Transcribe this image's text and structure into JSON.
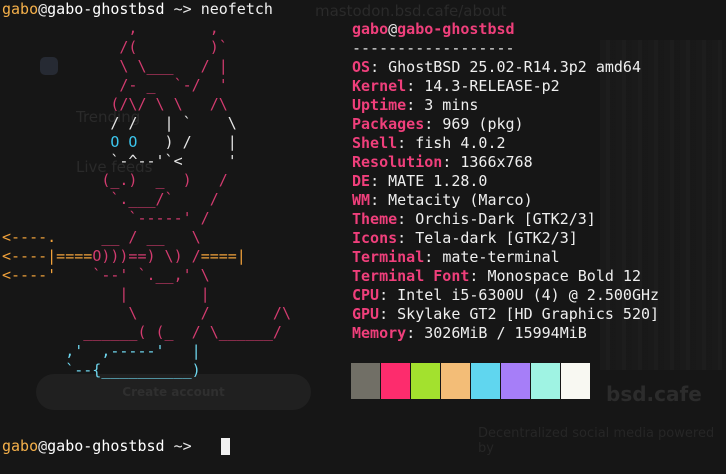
{
  "background": {
    "top_text": "mastodon.bsd.cafe/about",
    "side_items": [
      "Trending",
      "Live feeds"
    ],
    "button_label": "Create account",
    "brand": "bsd.cafe",
    "tagline": "Decentralized social media powered by"
  },
  "prompt1": {
    "user": "gabo",
    "at": "@",
    "host": "gabo-ghostbsd",
    "arrow": " ~> ",
    "command": "neofetch"
  },
  "prompt2": {
    "user": "gabo",
    "at": "@",
    "host": "gabo-ghostbsd",
    "arrow": " ~> "
  },
  "info": {
    "title_user": "gabo",
    "title_at": "@",
    "title_host": "gabo-ghostbsd",
    "separator": "------------------",
    "rows": [
      {
        "label": "OS",
        "value": "GhostBSD 25.02-R14.3p2 amd64"
      },
      {
        "label": "Kernel",
        "value": "14.3-RELEASE-p2"
      },
      {
        "label": "Uptime",
        "value": "3 mins"
      },
      {
        "label": "Packages",
        "value": "969 (pkg)"
      },
      {
        "label": "Shell",
        "value": "fish 4.0.2"
      },
      {
        "label": "Resolution",
        "value": "1366x768"
      },
      {
        "label": "DE",
        "value": "MATE 1.28.0"
      },
      {
        "label": "WM",
        "value": "Metacity (Marco)"
      },
      {
        "label": "Theme",
        "value": "Orchis-Dark [GTK2/3]"
      },
      {
        "label": "Icons",
        "value": "Tela-dark [GTK2/3]"
      },
      {
        "label": "Terminal",
        "value": "mate-terminal"
      },
      {
        "label": "Terminal Font",
        "value": "Monospace Bold 12"
      },
      {
        "label": "CPU",
        "value": "Intel i5-6300U (4) @ 2.500GHz"
      },
      {
        "label": "GPU",
        "value": "Skylake GT2 [HD Graphics 520]"
      },
      {
        "label": "Memory",
        "value": "3026MiB / 15994MiB"
      }
    ]
  },
  "art": {
    "l1": "              ,        ,",
    "l2": "             /(        )`",
    "l3": "             \\ \\___   / |",
    "l4": "             /- _  `-/  '",
    "l5": "            (/\\/ \\ \\   /\\",
    "l6": "            / /   | `    \\",
    "l7_eyes": "O O",
    "l7_pre": "            ",
    "l7_post": "   ) /    |",
    "l8": "            `-^--'`<     '",
    "l9": "           (_.)  _  )   /",
    "l10": "            `.___/`    /",
    "l11": "              `-----' /",
    "l12_orange": "<----.",
    "l12_rest": "     __ / __   \\",
    "l13_orange": "<----|====",
    "l13_red": "O)))==) \\) /",
    "l13_orange2": "====|",
    "l14_orange": "<----'",
    "l14_rest": "    `--' `.__,' \\",
    "l15": "             |        |",
    "l16": "              \\       /       /\\",
    "l17": "         ______( (_  / \\______/",
    "l18_cyan": "       ,'  ,-----'   |",
    "l19_cyan": "       `--{__________)"
  },
  "palette": [
    "#716f66",
    "#fd2c6d",
    "#a3e12e",
    "#f3bd77",
    "#60d6ef",
    "#a67ef8",
    "#9ff3e3",
    "#f8f8f2"
  ]
}
